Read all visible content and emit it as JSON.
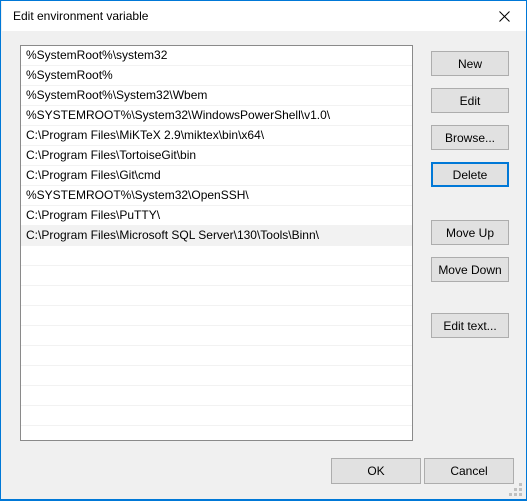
{
  "window": {
    "title": "Edit environment variable",
    "accent_color": "#0078D7",
    "body_color": "#F0F0F0",
    "titlebar_color": "#FFFFFF"
  },
  "close_button": {
    "name": "close-icon",
    "glyph": "✕"
  },
  "path_list": {
    "selected_index": 9,
    "entries": [
      "%SystemRoot%\\system32",
      "%SystemRoot%",
      "%SystemRoot%\\System32\\Wbem",
      "%SYSTEMROOT%\\System32\\WindowsPowerShell\\v1.0\\",
      "C:\\Program Files\\MiKTeX 2.9\\miktex\\bin\\x64\\",
      "C:\\Program Files\\TortoiseGit\\bin",
      "C:\\Program Files\\Git\\cmd",
      "%SYSTEMROOT%\\System32\\OpenSSH\\",
      "C:\\Program Files\\PuTTY\\",
      "C:\\Program Files\\Microsoft SQL Server\\130\\Tools\\Binn\\"
    ],
    "empty_row_count": 9
  },
  "side_buttons": {
    "new": "New",
    "edit": "Edit",
    "browse": "Browse...",
    "delete": "Delete",
    "move_up": "Move Up",
    "move_down": "Move Down",
    "edit_text": "Edit text...",
    "focused": "delete"
  },
  "dialog_buttons": {
    "ok": "OK",
    "cancel": "Cancel"
  }
}
